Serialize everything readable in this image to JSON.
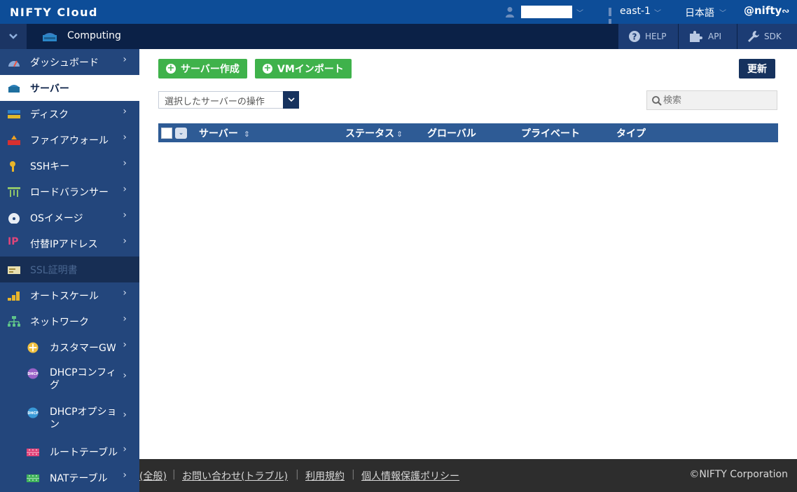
{
  "topbar": {
    "brand": "NIFTY Cloud",
    "region": "east-1",
    "language": "日本語",
    "logo": "@nifty"
  },
  "subbar": {
    "service": "Computing",
    "help": "HELP",
    "api": "API",
    "sdk": "SDK"
  },
  "sidebar": {
    "items": [
      {
        "label": "ダッシュボード",
        "icon": "dashboard-icon"
      },
      {
        "label": "サーバー",
        "icon": "server-icon"
      },
      {
        "label": "ディスク",
        "icon": "disk-icon"
      },
      {
        "label": "ファイアウォール",
        "icon": "firewall-icon"
      },
      {
        "label": "SSHキー",
        "icon": "key-icon"
      },
      {
        "label": "ロードバランサー",
        "icon": "load-balancer-icon"
      },
      {
        "label": "OSイメージ",
        "icon": "disc-icon"
      },
      {
        "label": "付替IPアドレス",
        "icon": "ip-icon"
      },
      {
        "label": "SSL証明書",
        "icon": "certificate-icon"
      },
      {
        "label": "オートスケール",
        "icon": "autoscale-icon"
      },
      {
        "label": "ネットワーク",
        "icon": "network-icon"
      },
      {
        "label": "カスタマーGW",
        "icon": "gateway-icon"
      },
      {
        "label_line1": "DHCPコンフィ",
        "label_line2": "グ",
        "icon": "dhcp-config-icon"
      },
      {
        "label_line1": "DHCPオプショ",
        "label_line2": "ン",
        "icon": "dhcp-option-icon"
      },
      {
        "label": "ルートテーブル",
        "icon": "route-table-icon"
      },
      {
        "label": "NATテーブル",
        "icon": "nat-table-icon"
      }
    ],
    "dhcp_badge": "DHCP",
    "ip_badge": "IP"
  },
  "toolbar": {
    "create_server": "サーバー作成",
    "vm_import": "VMインポート",
    "refresh": "更新",
    "operation_select": "選択したサーバーの操作",
    "search_placeholder": "検索"
  },
  "table": {
    "columns": [
      "サーバー",
      "ステータス",
      "グローバル",
      "プライベート",
      "タイプ"
    ]
  },
  "footer": {
    "links": [
      "(全般)",
      "お問い合わせ(トラブル)",
      "利用規約",
      "個人情報保護ポリシー"
    ],
    "copyright": "©NIFTY Corporation"
  },
  "colors": {
    "topbar": "#0d4d98",
    "subbar": "#0b2147",
    "sidebar": "#23467c",
    "green_button": "#3fb24b",
    "table_header": "#2e5b95"
  }
}
